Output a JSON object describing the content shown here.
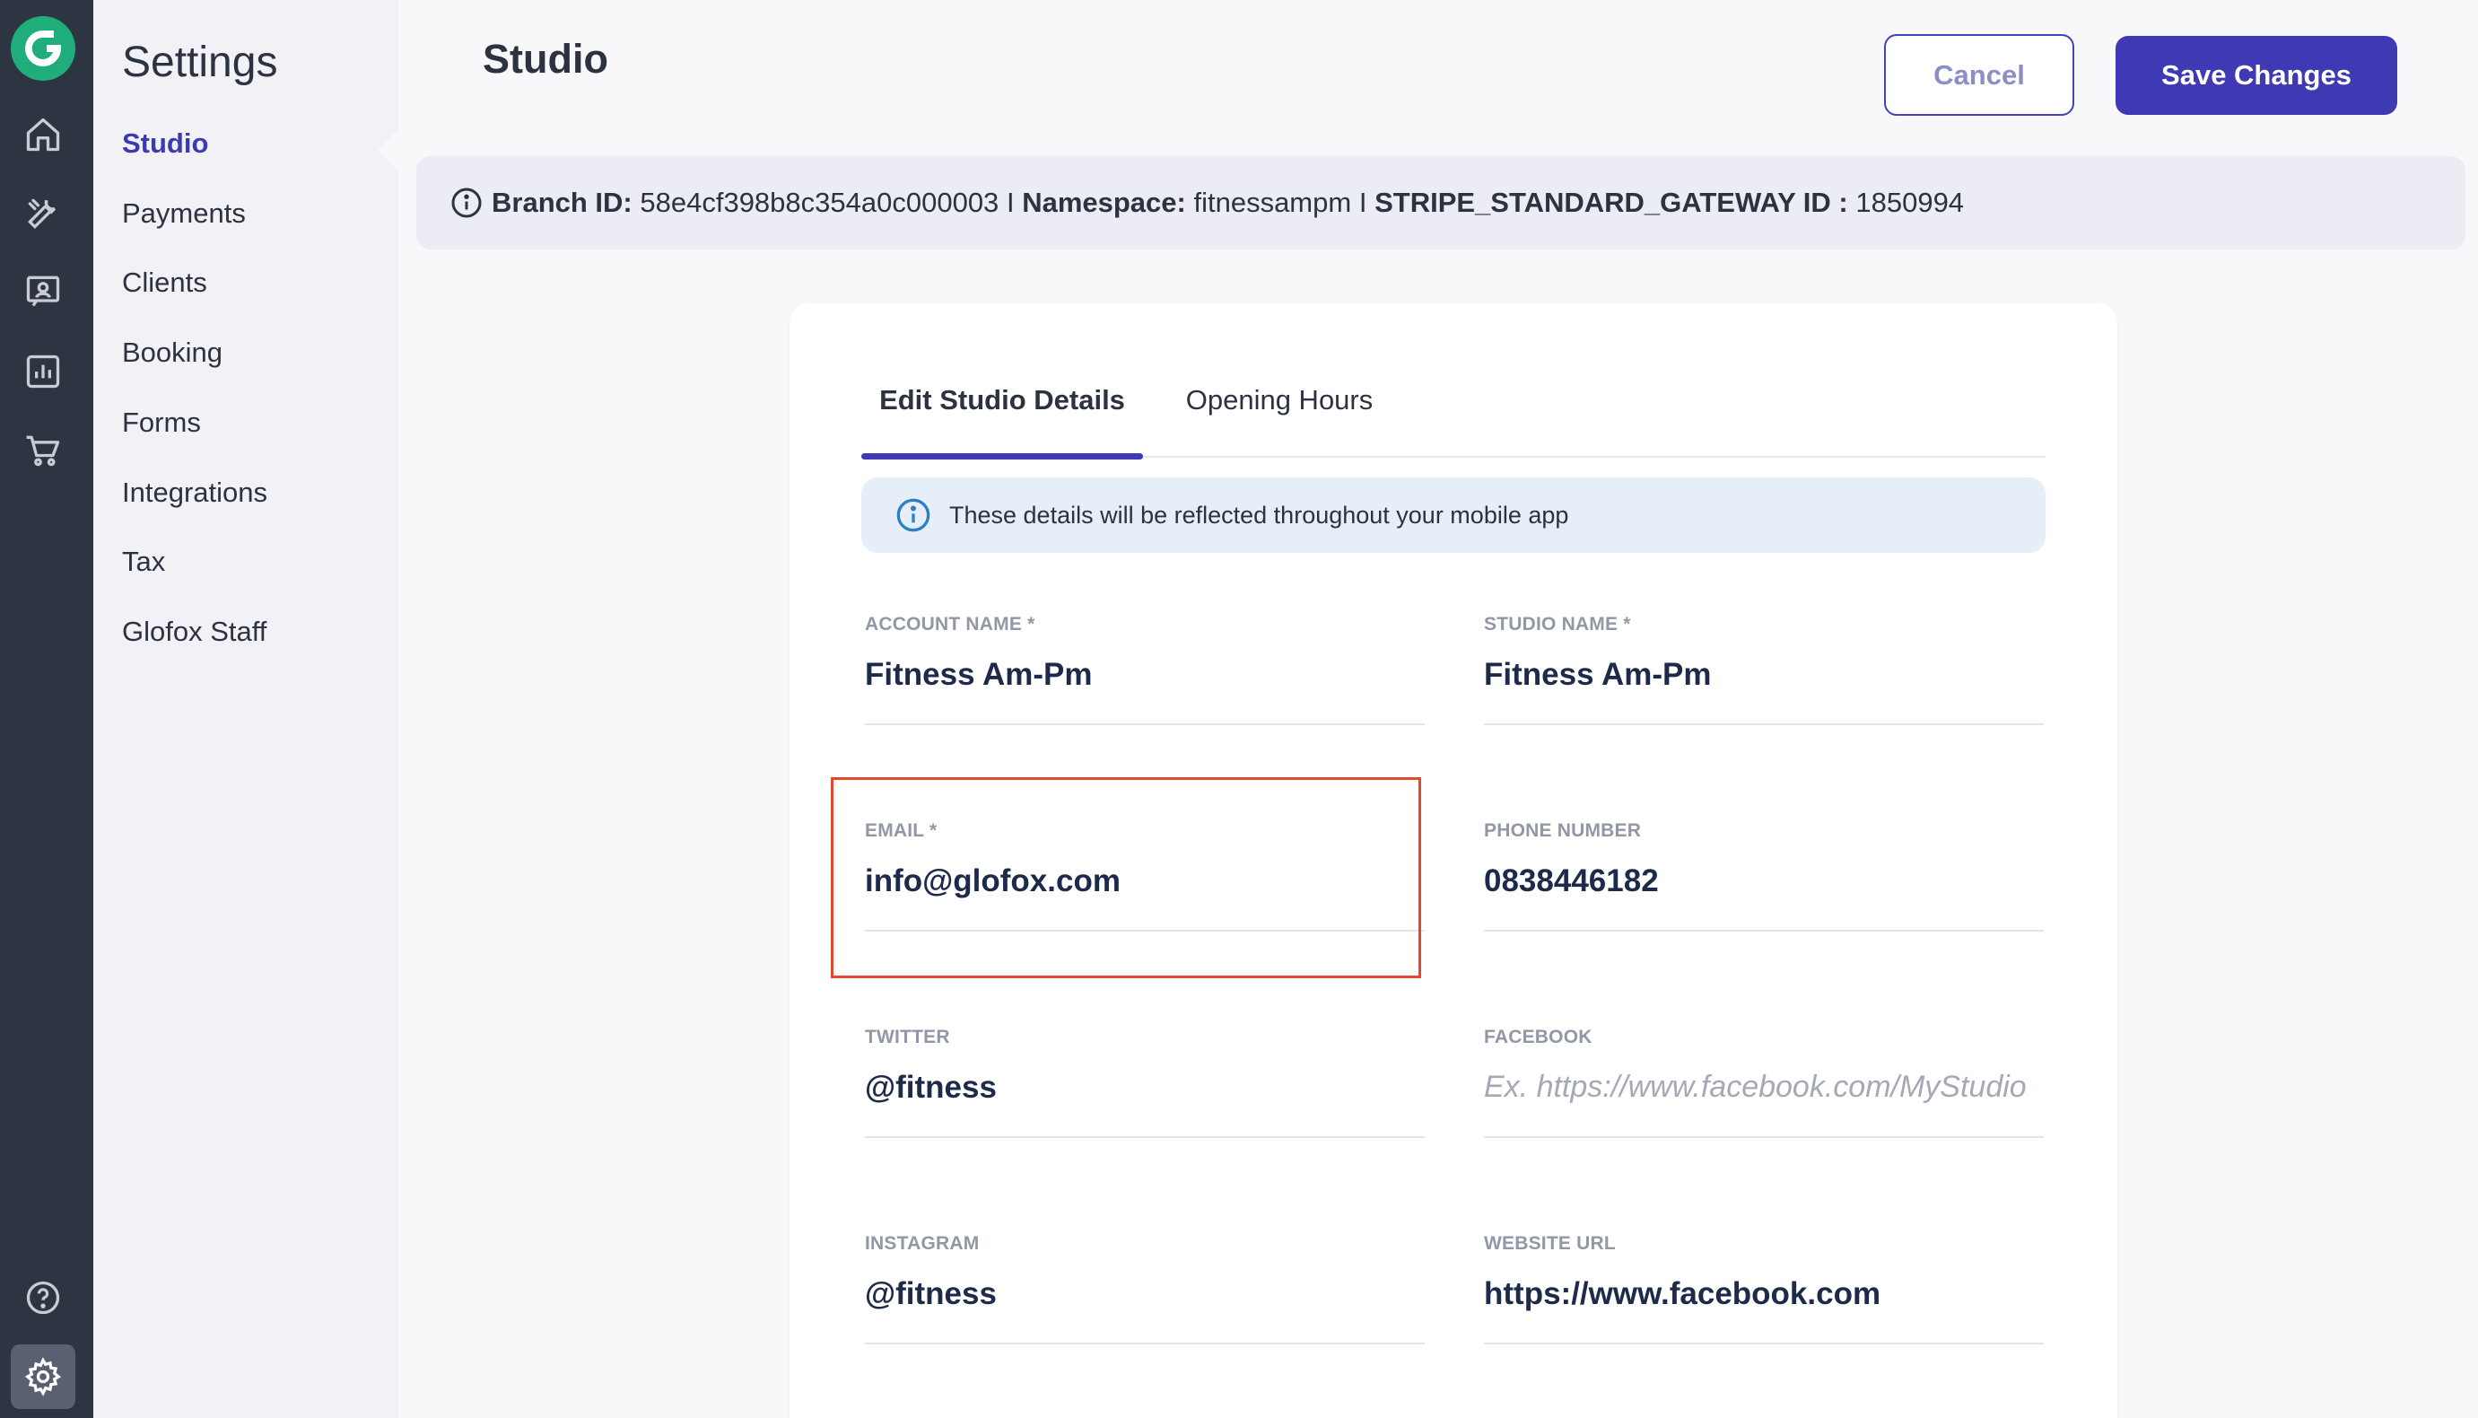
{
  "sidebar_rail": {
    "icons": [
      "glofox-logo-icon",
      "home-icon",
      "wrench-icon",
      "contact-card-icon",
      "chart-icon",
      "cart-icon",
      "help-icon",
      "gear-icon"
    ]
  },
  "settings_nav": {
    "title": "Settings",
    "items": [
      {
        "label": "Studio",
        "active": true
      },
      {
        "label": "Payments"
      },
      {
        "label": "Clients"
      },
      {
        "label": "Booking"
      },
      {
        "label": "Forms"
      },
      {
        "label": "Integrations"
      },
      {
        "label": "Tax"
      },
      {
        "label": "Glofox Staff"
      }
    ]
  },
  "header": {
    "title": "Studio",
    "cancel_label": "Cancel",
    "save_label": "Save Changes"
  },
  "info_banner": {
    "branch_label": "Branch ID:",
    "branch_value": "58e4cf398b8c354a0c000003",
    "namespace_label": "Namespace:",
    "namespace_value": "fitnessampm",
    "gateway_label": "STRIPE_STANDARD_GATEWAY ID :",
    "gateway_value": "1850994",
    "separator": "I"
  },
  "tabs": [
    {
      "label": "Edit Studio Details",
      "active": true
    },
    {
      "label": "Opening Hours"
    }
  ],
  "note": {
    "text": "These details will be reflected throughout your mobile app"
  },
  "fields": {
    "account_name": {
      "label": "ACCOUNT NAME",
      "required_mark": "*",
      "value": "Fitness Am-Pm"
    },
    "studio_name": {
      "label": "STUDIO NAME",
      "required_mark": "*",
      "value": "Fitness Am-Pm"
    },
    "email": {
      "label": "EMAIL",
      "required_mark": "*",
      "value": "info@glofox.com"
    },
    "phone": {
      "label": "PHONE NUMBER",
      "value": "0838446182"
    },
    "twitter": {
      "label": "TWITTER",
      "value": "@fitness"
    },
    "facebook": {
      "label": "FACEBOOK",
      "value": "",
      "placeholder": "Ex. https://www.facebook.com/MyStudio"
    },
    "instagram": {
      "label": "INSTAGRAM",
      "value": "@fitness"
    },
    "website": {
      "label": "WEBSITE URL",
      "value": "https://www.facebook.com"
    }
  },
  "colors": {
    "rail": "#2e3542",
    "accent": "#3f3ab4",
    "brand_green": "#1fae7b",
    "highlight": "#e24a2e"
  }
}
